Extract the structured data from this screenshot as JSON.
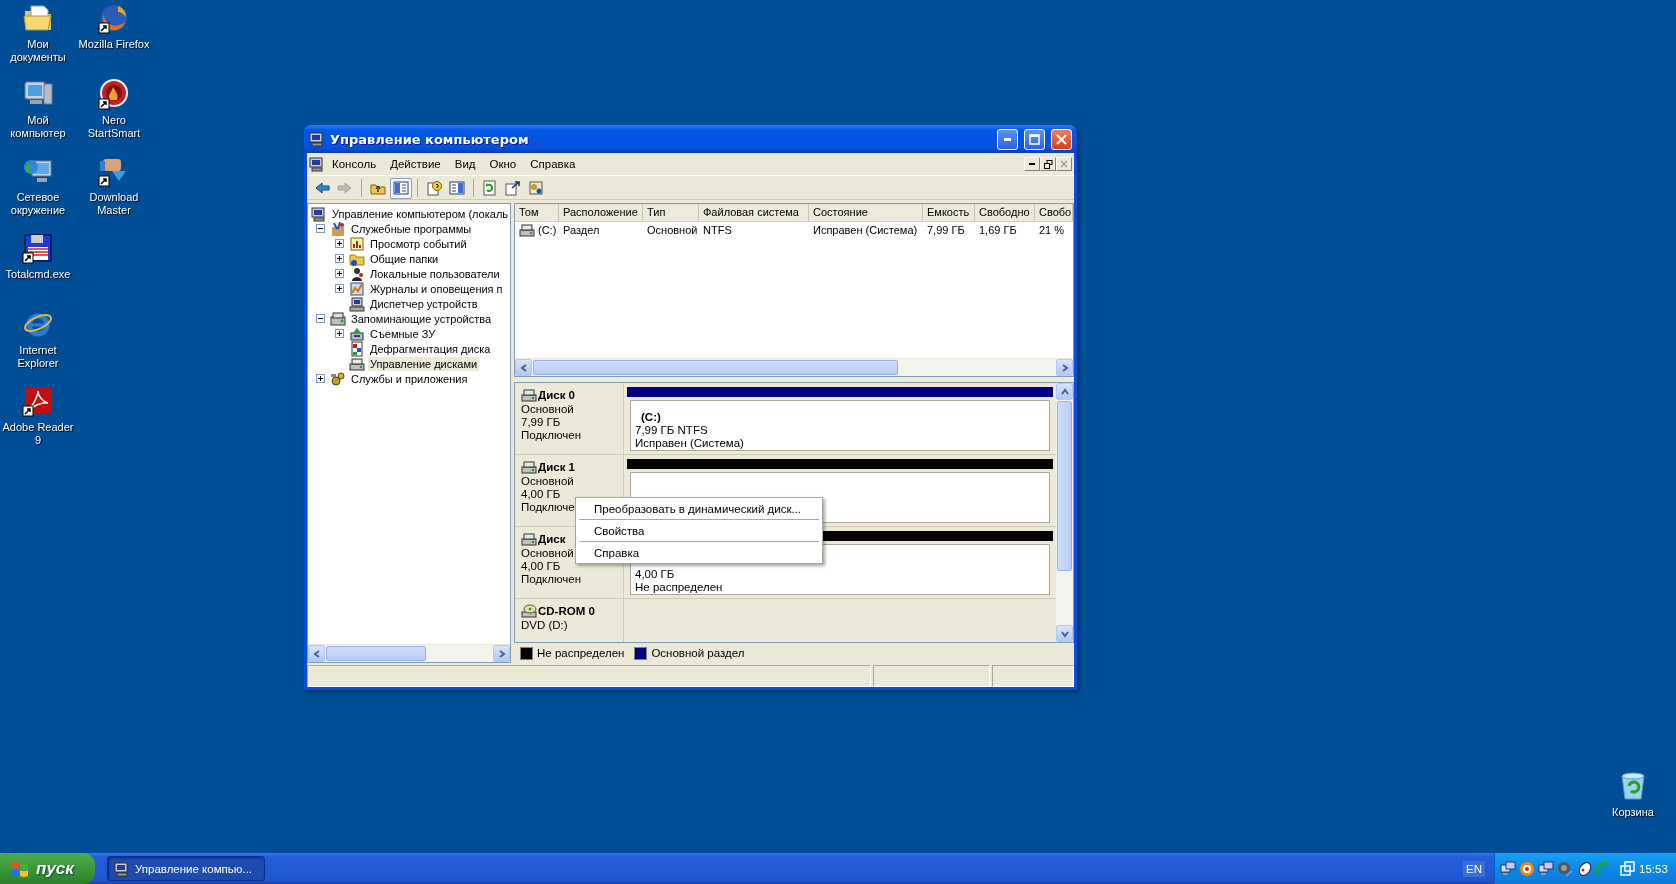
{
  "desktop_icons": [
    {
      "label": "Мои документы",
      "kind": "documents",
      "shortcut": false
    },
    {
      "label": "Mozilla Firefox",
      "kind": "firefox",
      "shortcut": true
    },
    {
      "label": "Мой компьютер",
      "kind": "computer",
      "shortcut": false
    },
    {
      "label": "Nero StartSmart",
      "kind": "nero",
      "shortcut": true
    },
    {
      "label": "Сетевое окружение",
      "kind": "network",
      "shortcut": false
    },
    {
      "label": "Download Master",
      "kind": "download",
      "shortcut": true
    },
    {
      "label": "Totalcmd.exe",
      "kind": "floppy",
      "shortcut": true
    },
    {
      "label": "Internet Explorer",
      "kind": "ie",
      "shortcut": false
    },
    {
      "label": "Adobe Reader 9",
      "kind": "pdf",
      "shortcut": true
    },
    {
      "label": "Корзина",
      "kind": "recycle",
      "shortcut": false
    }
  ],
  "window": {
    "title": "Управление компьютером",
    "menu": [
      "Консоль",
      "Действие",
      "Вид",
      "Окно",
      "Справка"
    ],
    "toolbar": [
      {
        "kind": "back",
        "disabled": false,
        "pressed": false
      },
      {
        "kind": "forward",
        "disabled": true,
        "pressed": false
      },
      {
        "kind": "separator"
      },
      {
        "kind": "up",
        "disabled": false,
        "pressed": false
      },
      {
        "kind": "tree",
        "disabled": false,
        "pressed": true
      },
      {
        "kind": "separator"
      },
      {
        "kind": "properties",
        "disabled": false,
        "pressed": false
      },
      {
        "kind": "panel",
        "disabled": false,
        "pressed": false
      },
      {
        "kind": "separator"
      },
      {
        "kind": "refresh",
        "disabled": false,
        "pressed": false
      },
      {
        "kind": "export",
        "disabled": false,
        "pressed": false
      },
      {
        "kind": "help",
        "disabled": false,
        "pressed": false
      }
    ],
    "tree": [
      {
        "label": "Управление компьютером (локаль",
        "kind": "computer",
        "expandable": false,
        "selected": false,
        "children": [
          {
            "label": "Служебные программы",
            "kind": "tools",
            "expandable": true,
            "expanded": true,
            "selected": false,
            "children": [
              {
                "label": "Просмотр событий",
                "kind": "events",
                "expandable": true,
                "expanded": false,
                "selected": false
              },
              {
                "label": "Общие папки",
                "kind": "folder",
                "expandable": true,
                "expanded": false,
                "selected": false
              },
              {
                "label": "Локальные пользователи",
                "kind": "users",
                "expandable": true,
                "expanded": false,
                "selected": false
              },
              {
                "label": "Журналы и оповещения п",
                "kind": "logs",
                "expandable": true,
                "expanded": false,
                "selected": false
              },
              {
                "label": "Диспетчер устройств",
                "kind": "devices",
                "expandable": false,
                "selected": false
              }
            ]
          },
          {
            "label": "Запоминающие устройства",
            "kind": "storage",
            "expandable": true,
            "expanded": true,
            "selected": false,
            "children": [
              {
                "label": "Съемные ЗУ",
                "kind": "removable",
                "expandable": true,
                "expanded": false,
                "selected": false
              },
              {
                "label": "Дефрагментация диска",
                "kind": "defrag",
                "expandable": false,
                "selected": false
              },
              {
                "label": "Управление дисками",
                "kind": "disk",
                "expandable": false,
                "selected": true
              }
            ]
          },
          {
            "label": "Службы и приложения",
            "kind": "services",
            "expandable": true,
            "expanded": false,
            "selected": false
          }
        ]
      }
    ],
    "volumes": {
      "columns": [
        "Том",
        "Расположение",
        "Тип",
        "Файловая система",
        "Состояние",
        "Емкость",
        "Свободно",
        "Свобо"
      ],
      "rows": [
        [
          "(C:)",
          "Раздел",
          "Основной",
          "NTFS",
          "Исправен (Система)",
          "7,99 ГБ",
          "1,69 ГБ",
          "21 %"
        ]
      ]
    },
    "disks": [
      {
        "name": "Диск 0",
        "kind": "disk",
        "type": "Основной",
        "size": "7,99 ГБ",
        "status": "Подключен",
        "partitions": [
          {
            "kind": "primary",
            "label": "(C:)",
            "size": "7,99 ГБ NTFS",
            "status": "Исправен (Система)"
          }
        ]
      },
      {
        "name": "Диск 1",
        "kind": "disk",
        "type": "Основной",
        "size": "4,00 ГБ",
        "status": "Подключе",
        "partitions": [
          {
            "kind": "unallocated"
          }
        ]
      },
      {
        "name": "Диск",
        "kind": "disk",
        "type": "Основной",
        "size": "4,00 ГБ",
        "status": "Подключен",
        "partitions": [
          {
            "kind": "unallocated",
            "size": "4,00 ГБ",
            "status": "Не распределен"
          }
        ]
      },
      {
        "name": "CD-ROM 0",
        "kind": "cdrom",
        "type": "DVD (D:)"
      }
    ],
    "legend": [
      {
        "label": "Не распределен",
        "kind": "unallocated",
        "color": "#000000"
      },
      {
        "label": "Основной раздел",
        "kind": "primary",
        "color": "#000080"
      }
    ],
    "context_menu": [
      {
        "kind": "item",
        "label": "Преобразовать в динамический диск..."
      },
      {
        "kind": "separator"
      },
      {
        "kind": "item",
        "label": "Свойства"
      },
      {
        "kind": "separator"
      },
      {
        "kind": "item",
        "label": "Справка"
      }
    ]
  },
  "taskbar": {
    "start": "пуск",
    "tasks": [
      {
        "label": "Управление компью...",
        "selected": true
      }
    ],
    "language": "EN",
    "clock": "15:53"
  }
}
